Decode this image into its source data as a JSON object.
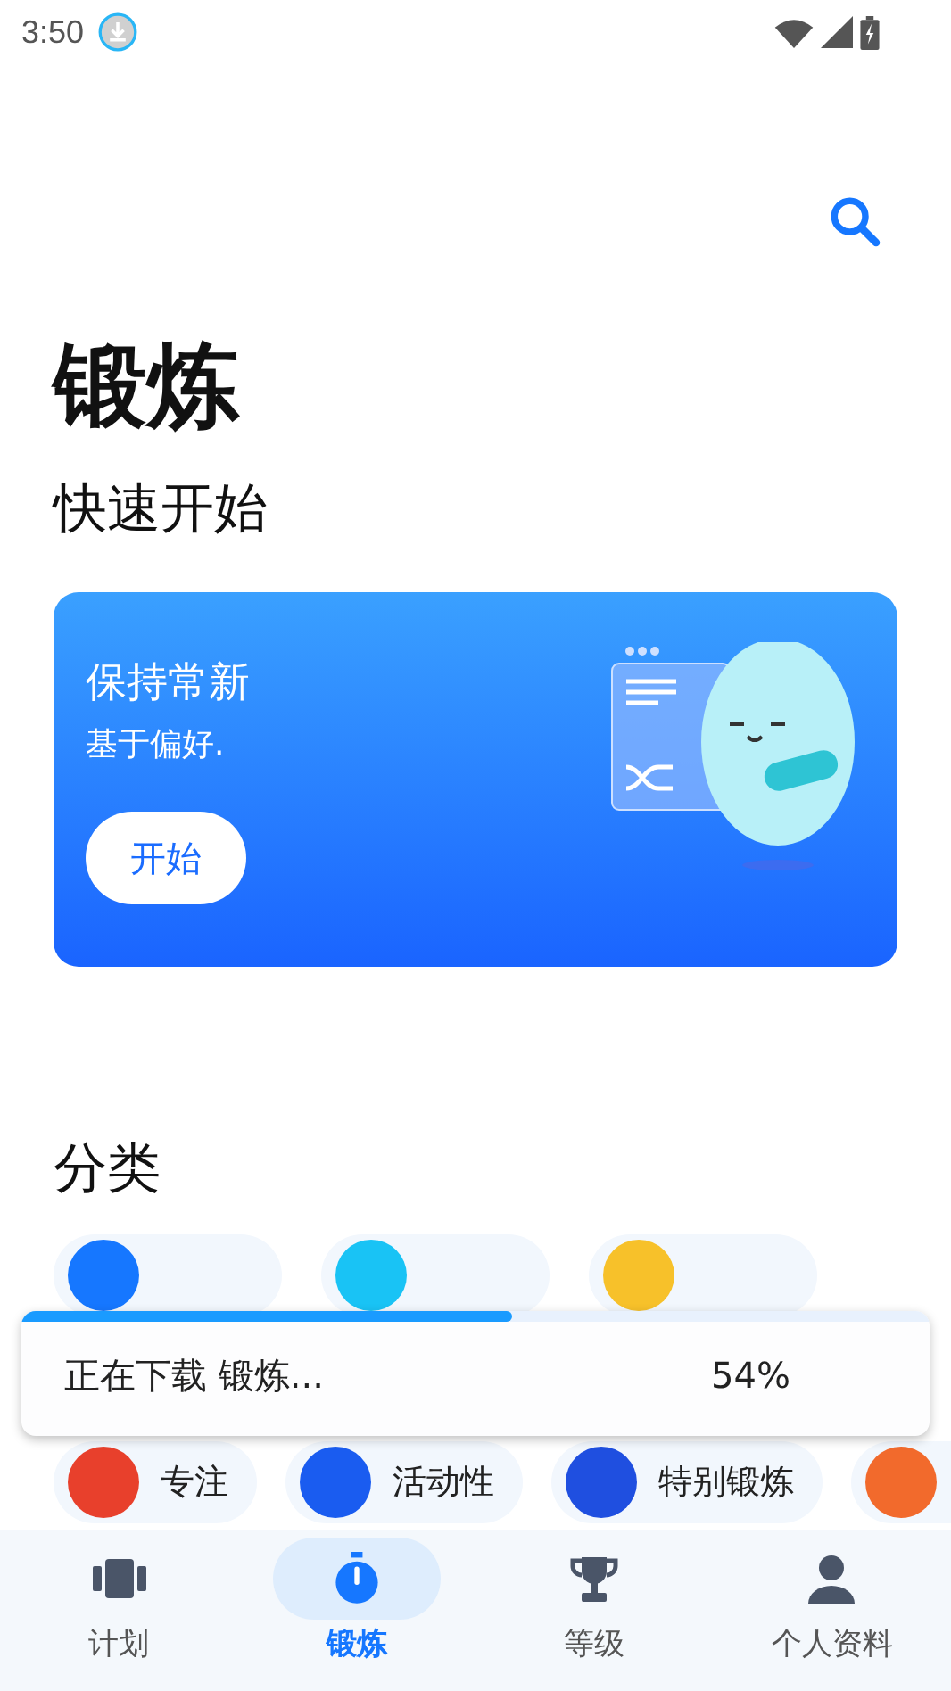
{
  "status_bar": {
    "time": "3:50"
  },
  "page_title": "锻炼",
  "quick_start": {
    "heading": "快速开始",
    "card": {
      "title": "保持常新",
      "subtitle": "基于偏好.",
      "button": "开始"
    }
  },
  "categories": {
    "heading": "分类",
    "top_row": [
      {
        "color": "#1677ff"
      },
      {
        "color": "#19c3f5"
      },
      {
        "color": "#f7c12a"
      }
    ],
    "bottom_row": [
      {
        "label": "专注",
        "color": "#e8402c"
      },
      {
        "label": "活动性",
        "color": "#1a5cf0"
      },
      {
        "label": "特别锻炼",
        "color": "#1f4fe0"
      },
      {
        "color": "#f26a2c"
      }
    ]
  },
  "download_toast": {
    "text": "正在下载 锻炼...",
    "percent": "54%",
    "level": 0.54
  },
  "bottom_nav": [
    {
      "label": "计划",
      "kind": "plan",
      "selected": false
    },
    {
      "label": "锻炼",
      "kind": "timer",
      "selected": true
    },
    {
      "label": "等级",
      "kind": "trophy",
      "selected": false
    },
    {
      "label": "个人资料",
      "kind": "person",
      "selected": false
    }
  ]
}
